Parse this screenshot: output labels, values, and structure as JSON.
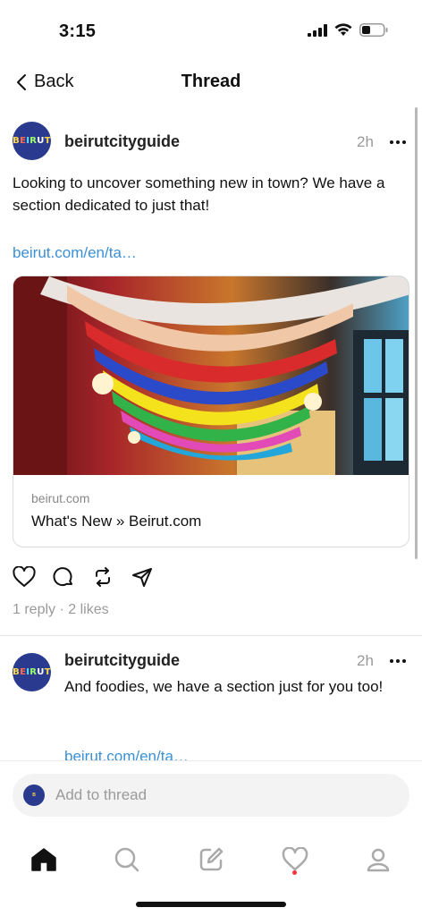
{
  "status_bar": {
    "time": "3:15"
  },
  "nav": {
    "back_label": "Back",
    "title": "Thread"
  },
  "posts": [
    {
      "username": "beirutcityguide",
      "time_ago": "2h",
      "text": "Looking to uncover something new in town? We have a section dedicated to just that!",
      "link": "beirut.com/en/ta…",
      "card": {
        "domain": "beirut.com",
        "title": "What's New » Beirut.com"
      },
      "stats": "1 reply · 2 likes"
    },
    {
      "username": "beirutcityguide",
      "time_ago": "2h",
      "text": "And foodies, we have a section just for you too!",
      "link": "beirut.com/en/ta…"
    }
  ],
  "avatar_logo": "beirut",
  "composer": {
    "placeholder": "Add to thread"
  },
  "tabs": [
    "home-icon",
    "search-icon",
    "compose-icon",
    "activity-icon",
    "profile-icon"
  ],
  "colors": {
    "link": "#3b8fd6",
    "avatar_bg": "#2a3b8f",
    "notification_dot": "#ff3040"
  }
}
